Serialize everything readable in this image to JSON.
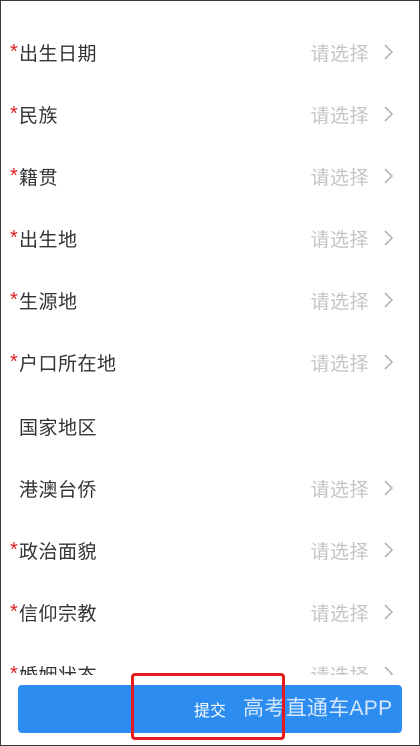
{
  "form": {
    "required_mark": "*",
    "rows": [
      {
        "label": "出生日期",
        "value": "请选择",
        "required": true,
        "has_value": true
      },
      {
        "label": "民族",
        "value": "请选择",
        "required": true,
        "has_value": true
      },
      {
        "label": "籍贯",
        "value": "请选择",
        "required": true,
        "has_value": true
      },
      {
        "label": "出生地",
        "value": "请选择",
        "required": true,
        "has_value": true
      },
      {
        "label": "生源地",
        "value": "请选择",
        "required": true,
        "has_value": true
      },
      {
        "label": "户口所在地",
        "value": "请选择",
        "required": true,
        "has_value": true
      },
      {
        "label": "国家地区",
        "value": "",
        "required": false,
        "has_value": false
      },
      {
        "label": "港澳台侨",
        "value": "请选择",
        "required": false,
        "has_value": true
      },
      {
        "label": "政治面貌",
        "value": "请选择",
        "required": true,
        "has_value": true
      },
      {
        "label": "信仰宗教",
        "value": "请选择",
        "required": true,
        "has_value": true
      },
      {
        "label": "婚姻状态",
        "value": "请选择",
        "required": true,
        "has_value": true
      }
    ]
  },
  "footer": {
    "submit_label": "提交",
    "watermark": "高考直通车APP"
  },
  "colors": {
    "accent": "#2d8cf0",
    "required": "#e02020",
    "placeholder": "#c4c4c4",
    "highlight": "#e8191f"
  },
  "icons": {
    "row_arrow": "chevron-right-icon"
  }
}
